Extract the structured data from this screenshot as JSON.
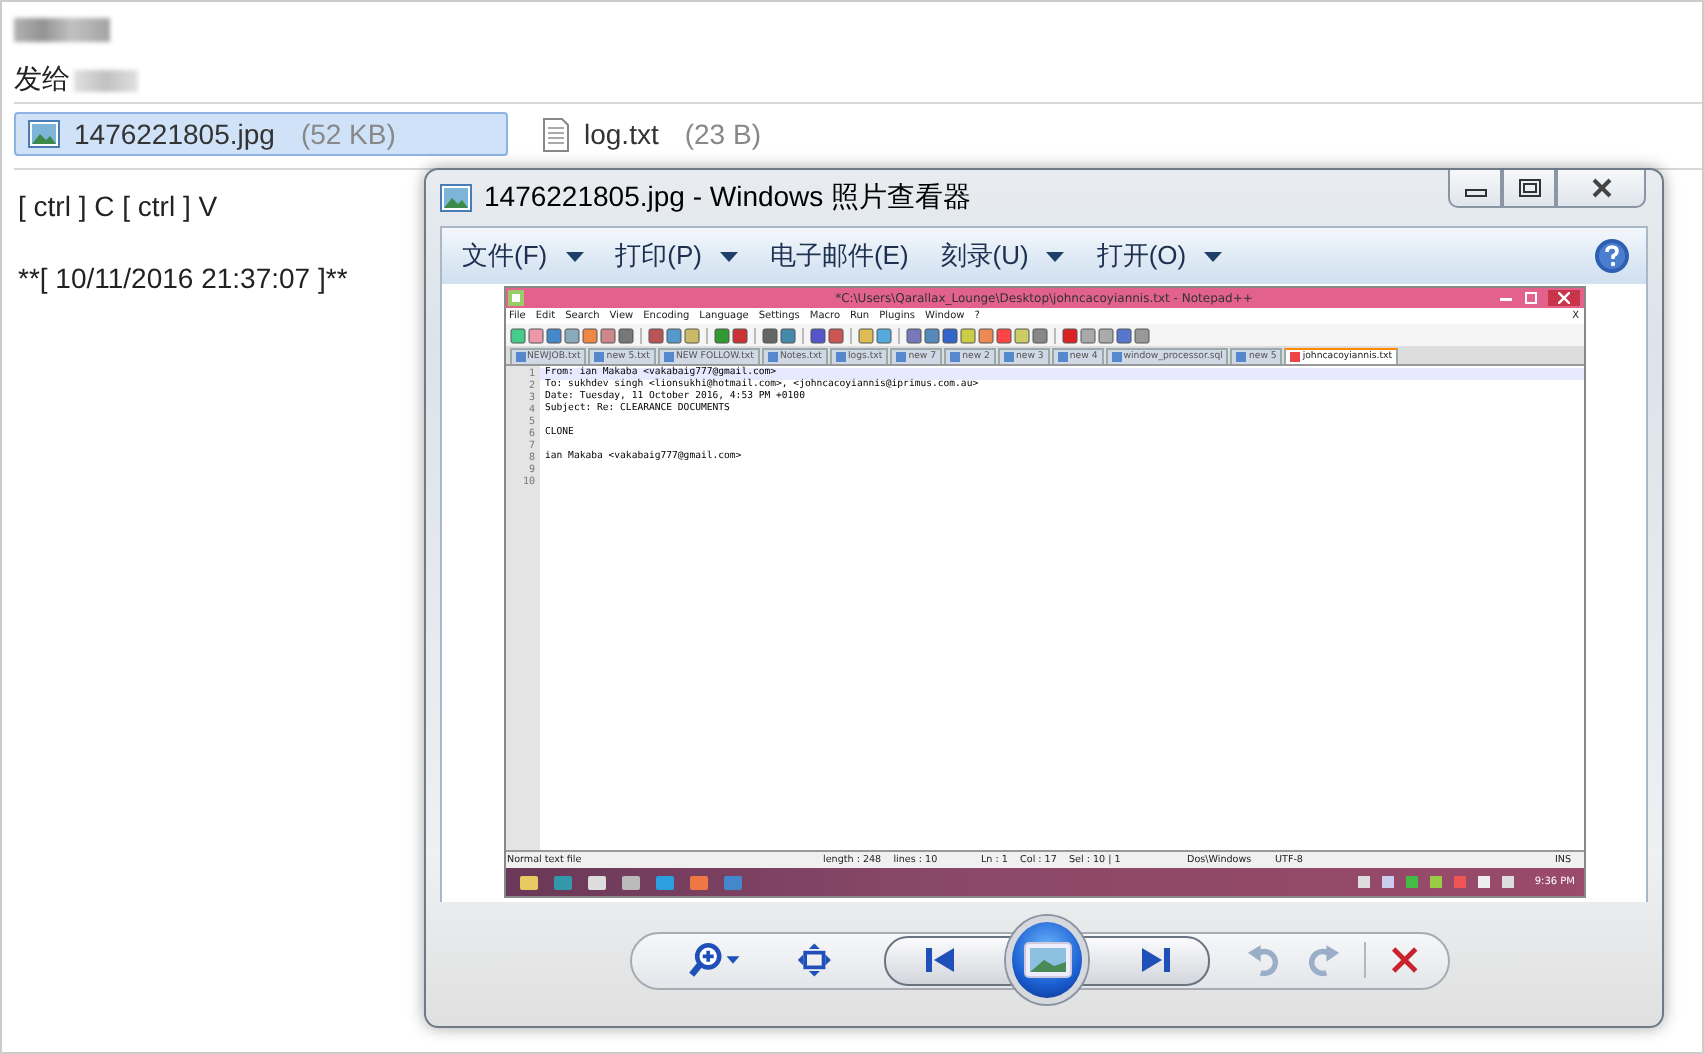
{
  "message": {
    "recipient_label": "发给",
    "attachments": [
      {
        "kind": "image",
        "name": "1476221805.jpg",
        "size": "(52 KB)",
        "selected": true
      },
      {
        "kind": "text",
        "name": "log.txt",
        "size": "(23 B)",
        "selected": false
      }
    ],
    "body": [
      "[ ctrl ] C [ ctrl ] V",
      "**[ 10/11/2016 21:37:07 ]**"
    ]
  },
  "viewer": {
    "title": "1476221805.jpg - Windows 照片查看器",
    "menu": [
      {
        "label": "文件(F)",
        "dropdown": true
      },
      {
        "label": "打印(P)",
        "dropdown": true
      },
      {
        "label": "电子邮件(E)",
        "dropdown": false
      },
      {
        "label": "刻录(U)",
        "dropdown": true
      },
      {
        "label": "打开(O)",
        "dropdown": true
      }
    ],
    "controls": [
      {
        "kind": "zoom",
        "disabled": false
      },
      {
        "kind": "fit",
        "disabled": false
      },
      {
        "kind": "previous",
        "disabled": false
      },
      {
        "kind": "slideshow",
        "disabled": false
      },
      {
        "kind": "next",
        "disabled": false
      },
      {
        "kind": "rotate-left",
        "disabled": true
      },
      {
        "kind": "rotate-right",
        "disabled": true
      },
      {
        "kind": "delete",
        "disabled": false
      }
    ],
    "image": {
      "title": "*C:\\Users\\Qarallax_Lounge\\Desktop\\johncacoyiannis.txt - Notepad++",
      "menu": [
        "File",
        "Edit",
        "Search",
        "View",
        "Encoding",
        "Language",
        "Settings",
        "Macro",
        "Run",
        "Plugins",
        "Window",
        "?"
      ],
      "close_mark": "X",
      "tabs": [
        {
          "label": "NEWJOB.txt",
          "selected": false
        },
        {
          "label": "new 5.txt",
          "selected": false
        },
        {
          "label": "NEW FOLLOW.txt",
          "selected": false
        },
        {
          "label": "Notes.txt",
          "selected": false
        },
        {
          "label": "logs.txt",
          "selected": false
        },
        {
          "label": "new 7",
          "selected": false
        },
        {
          "label": "new 2",
          "selected": false
        },
        {
          "label": "new 3",
          "selected": false
        },
        {
          "label": "new 4",
          "selected": false
        },
        {
          "label": "window_processor.sql",
          "selected": false
        },
        {
          "label": "new 5",
          "selected": false
        },
        {
          "label": "johncacoyiannis.txt",
          "selected": true
        }
      ],
      "lines": [
        {
          "number": "1",
          "text": "From: ian Makaba <vakabaig777@gmail.com>",
          "current": true
        },
        {
          "number": "2",
          "text": "To: sukhdev singh <lionsukhi@hotmail.com>, <johncacoyiannis@iprimus.com.au>",
          "current": false
        },
        {
          "number": "3",
          "text": "Date: Tuesday, 11 October 2016, 4:53 PM +0100",
          "current": false
        },
        {
          "number": "4",
          "text": "Subject: Re: CLEARANCE DOCUMENTS",
          "current": false
        },
        {
          "number": "5",
          "current": false
        },
        {
          "number": "6",
          "text": "CLONE",
          "current": false
        },
        {
          "number": "7",
          "current": false
        },
        {
          "number": "8",
          "text": "ian Makaba <vakabaig777@gmail.com>",
          "current": false
        },
        {
          "number": "9",
          "current": false
        },
        {
          "number": "10",
          "current": false
        }
      ],
      "status": [
        "Normal text file",
        "length : 248    lines : 10",
        "Ln : 1    Col : 17    Sel : 10 | 1",
        "Dos\\Windows",
        "UTF-8",
        "INS"
      ],
      "clock": "9:36 PM"
    }
  }
}
